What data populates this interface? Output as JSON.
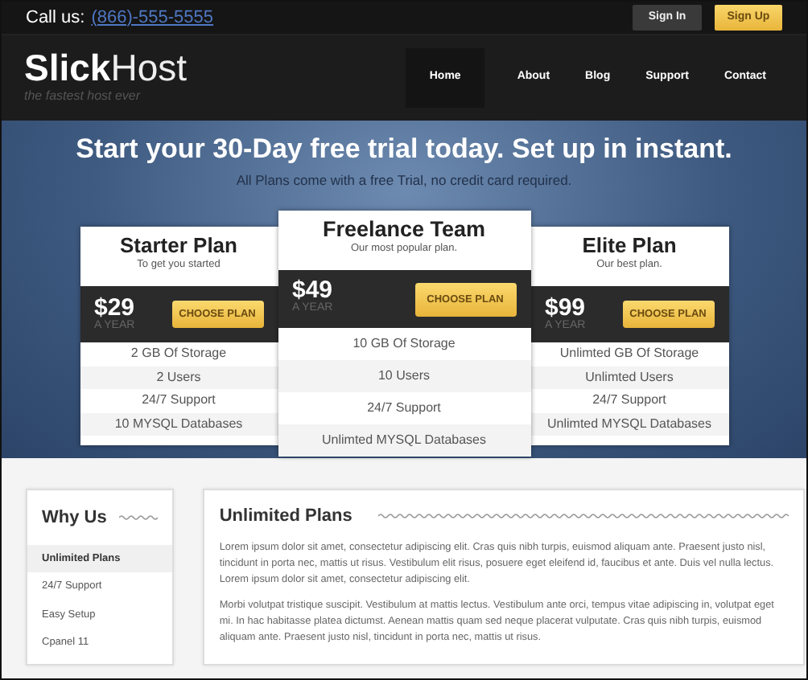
{
  "top_bar": {
    "call_label": "Call us:",
    "phone": "(866)-555-5555",
    "buttons": [
      {
        "label": "Sign In",
        "kind": "dark"
      },
      {
        "label": "Sign Up",
        "kind": "accent"
      }
    ]
  },
  "header": {
    "logo_bold": "Slick",
    "logo_light": "Host",
    "tagline": "the fastest host ever",
    "nav": [
      {
        "label": "Home",
        "selected": true
      },
      {
        "label": "About",
        "selected": false
      },
      {
        "label": "Blog",
        "selected": false
      },
      {
        "label": "Support",
        "selected": false
      },
      {
        "label": "Contact",
        "selected": false
      }
    ]
  },
  "hero": {
    "title": "Start your 30-Day free trial today. Set up in instant.",
    "subtitle": "All Plans come with a free Trial, no credit card required."
  },
  "plans": [
    {
      "name": "Starter Plan",
      "subtitle": "To get you started",
      "price": "$29",
      "period": "A YEAR",
      "button": "CHOOSE PLAN",
      "featured": false,
      "features": [
        "2 GB Of Storage",
        "2 Users",
        "24/7 Support",
        "10 MYSQL Databases"
      ]
    },
    {
      "name": "Freelance Team",
      "subtitle": "Our most popular plan.",
      "price": "$49",
      "period": "A YEAR",
      "button": "CHOOSE PLAN",
      "featured": true,
      "features": [
        "10 GB Of Storage",
        "10 Users",
        "24/7 Support",
        "Unlimted MYSQL Databases"
      ]
    },
    {
      "name": "Elite Plan",
      "subtitle": "Our best plan.",
      "price": "$99",
      "period": "A YEAR",
      "button": "CHOOSE PLAN",
      "featured": false,
      "features": [
        "Unlimted GB Of Storage",
        "Unlimted Users",
        "24/7 Support",
        "Unlimted MYSQL Databases"
      ]
    }
  ],
  "why_us": {
    "title": "Why Us",
    "items": [
      {
        "label": "Unlimited Plans",
        "selected": true
      },
      {
        "label": "24/7 Support",
        "selected": false
      },
      {
        "label": "Easy Setup",
        "selected": false
      },
      {
        "label": "Cpanel 11",
        "selected": false
      }
    ]
  },
  "content": {
    "title": "Unlimited Plans",
    "paragraphs": [
      "Lorem ipsum dolor sit amet, consectetur adipiscing elit. Cras quis nibh turpis, euismod aliquam ante. Praesent justo nisl, tincidunt in porta nec, mattis ut risus. Vestibulum elit risus, posuere eget eleifend id, faucibus et ante. Duis vel nulla lectus. Lorem ipsum dolor sit amet, consectetur adipiscing elit.",
      "Morbi volutpat tristique suscipit. Vestibulum at mattis lectus. Vestibulum ante orci, tempus vitae adipiscing in, volutpat eget mi. In hac habitasse platea dictumst. Aenean mattis quam sed neque placerat vulputate. Cras quis nibh turpis, euismod aliquam ante. Praesent justo nisl, tincidunt in porta nec, mattis ut risus."
    ]
  }
}
